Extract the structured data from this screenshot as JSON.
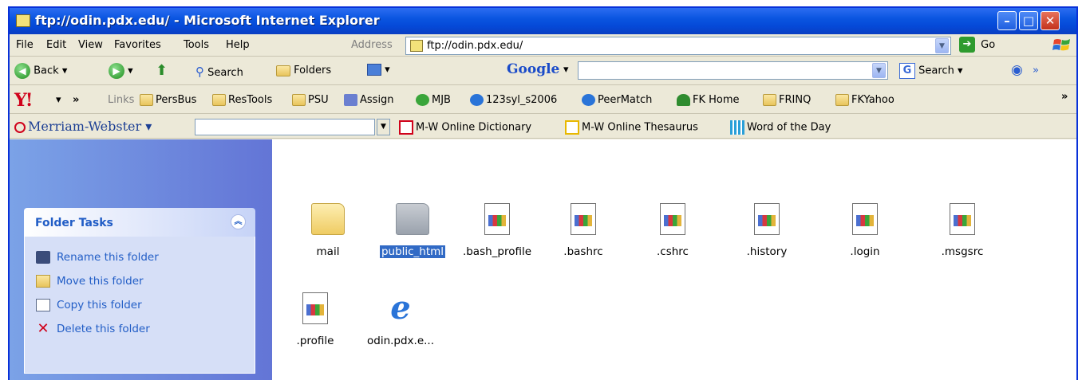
{
  "window": {
    "title": "ftp://odin.pdx.edu/ - Microsoft Internet Explorer"
  },
  "menu": {
    "items": [
      "File",
      "Edit",
      "View",
      "Favorites",
      "Tools",
      "Help"
    ]
  },
  "address": {
    "label": "Address",
    "value": "ftp://odin.pdx.edu/",
    "go_label": "Go"
  },
  "toolbar": {
    "back": "Back",
    "search": "Search",
    "folders": "Folders"
  },
  "google": {
    "logo": "Google",
    "search_label": "Search",
    "more": "»"
  },
  "links": {
    "more": "»",
    "label": "Links",
    "items": [
      "PersBus",
      "ResTools",
      "PSU",
      "Assign",
      "MJB",
      "123syl_s2006",
      "PeerMatch",
      "FK Home",
      "FRINQ",
      "FKYahoo"
    ],
    "end_more": "»"
  },
  "mw": {
    "logo": "Merriam-Webster",
    "items": [
      "M-W Online Dictionary",
      "M-W Online Thesaurus",
      "Word of the Day"
    ]
  },
  "tasks": {
    "title": "Folder Tasks",
    "items": [
      "Rename this folder",
      "Move this folder",
      "Copy this folder",
      "Delete this folder"
    ]
  },
  "files": [
    {
      "name": "mail",
      "kind": "folder"
    },
    {
      "name": "public_html",
      "kind": "folder",
      "selected": true
    },
    {
      "name": ".bash_profile",
      "kind": "document"
    },
    {
      "name": ".bashrc",
      "kind": "document"
    },
    {
      "name": ".cshrc",
      "kind": "document"
    },
    {
      "name": ".history",
      "kind": "document"
    },
    {
      "name": ".login",
      "kind": "document"
    },
    {
      "name": ".msgsrc",
      "kind": "document"
    },
    {
      "name": ".profile",
      "kind": "document"
    },
    {
      "name": "odin.pdx.e...",
      "kind": "ie-shortcut"
    }
  ],
  "colors": {
    "titlebar": "#0a55e0",
    "selection": "#316ac5",
    "task_text": "#215dc6",
    "pane": "#7ba2e7"
  }
}
